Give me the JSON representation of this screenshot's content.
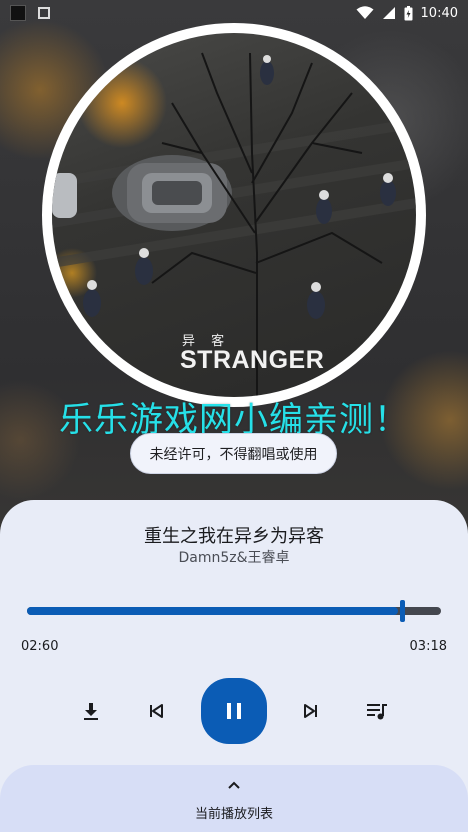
{
  "status_bar": {
    "time": "10:40"
  },
  "album": {
    "cover_subtitle": "异 客",
    "cover_title": "STRANGER"
  },
  "watermark": "乐乐游戏网小编亲测！",
  "notice": "未经许可，不得翻唱或使用",
  "song": {
    "title": "重生之我在异乡为异客",
    "artist": "Damn5z&王睿卓"
  },
  "progress": {
    "current": "02:60",
    "total": "03:18",
    "fraction": 0.905
  },
  "controls": {
    "download": "download-icon",
    "previous": "skip-previous-icon",
    "play_pause": "pause-icon",
    "next": "skip-next-icon",
    "playlist": "queue-music-icon"
  },
  "drawer": {
    "label": "当前播放列表"
  },
  "colors": {
    "accent": "#0b5cb5",
    "watermark": "#26e0e8",
    "sheet": "#e8ecf7"
  }
}
